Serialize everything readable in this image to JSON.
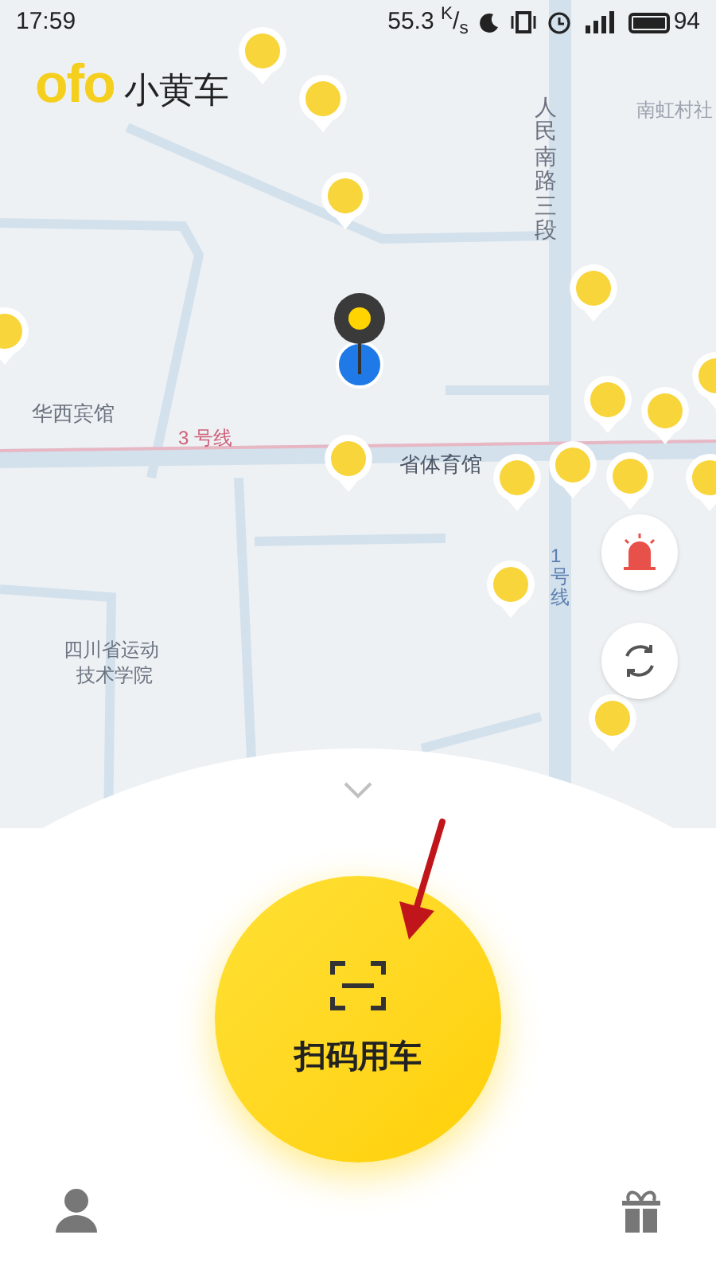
{
  "status_bar": {
    "time": "17:59",
    "speed": "55.3 $^{K}$/$_{s}$",
    "battery": "94"
  },
  "header": {
    "logo": "ofo",
    "title": "小黄车"
  },
  "map": {
    "labels": [
      "人民南路三段",
      "南虹村社",
      "华西宾馆",
      "3 号线",
      "省体育馆",
      "1号线",
      "四川省运动",
      "技术学院"
    ]
  },
  "main_button": {
    "label": "扫码用车"
  }
}
